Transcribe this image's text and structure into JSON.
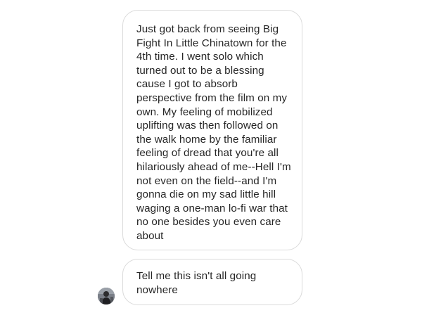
{
  "messages": [
    {
      "text": "Just got back from seeing Big Fight In Little Chinatown for the 4th time. I went solo which turned out to be a blessing cause I got to absorb perspective from the film on my own. My feeling of mobilized uplifting was then followed on the walk home by the familiar feeling of dread that you're all hilariously ahead of me--Hell I'm not even on the field--and I'm gonna die on my sad little hill waging a one-man lo-fi war that no one besides you even care about"
    },
    {
      "text": "Tell me this isn't all going nowhere"
    }
  ],
  "sender": {
    "avatar_icon": "user-avatar-photo"
  },
  "colors": {
    "bubble_border": "#dbdbdb",
    "text": "#262626",
    "background": "#ffffff"
  }
}
